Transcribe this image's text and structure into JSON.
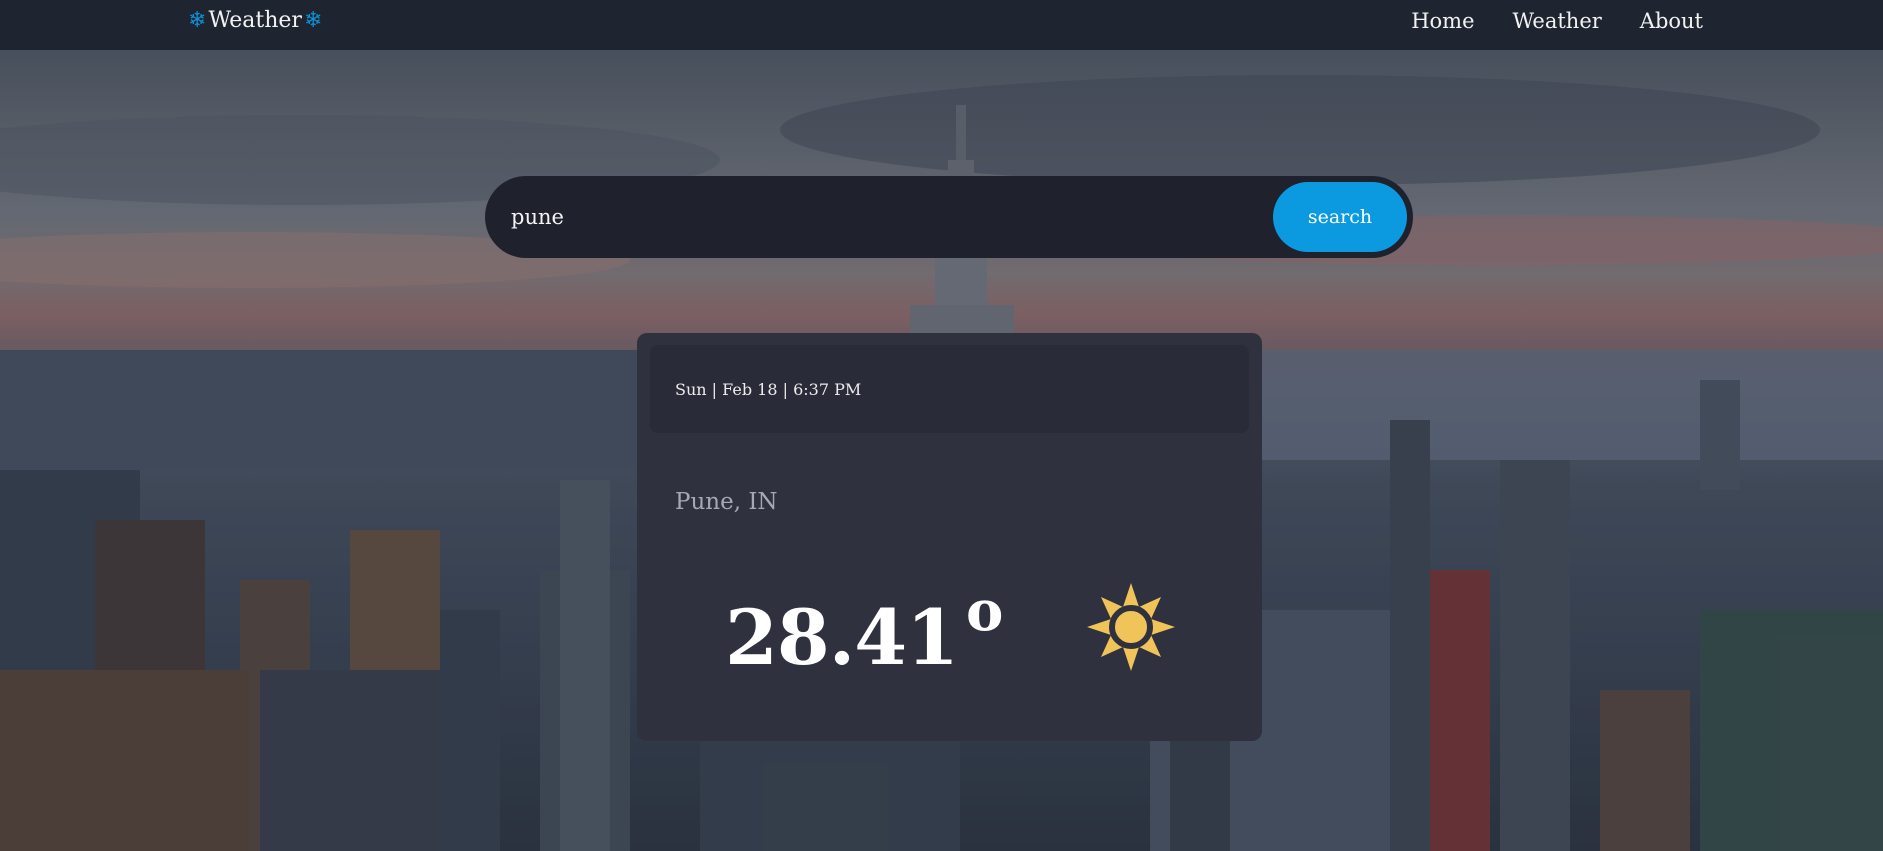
{
  "nav": {
    "brand_text": "Weather",
    "brand_icon": "snowflake-icon",
    "links": [
      {
        "label": "Home"
      },
      {
        "label": "Weather"
      },
      {
        "label": "About"
      }
    ]
  },
  "search": {
    "value": "pune",
    "button_label": "search"
  },
  "card": {
    "date": "Sun | Feb 18 | 6:37 PM",
    "location": "Pune, IN",
    "temperature": "28.41",
    "degree_symbol": "o",
    "condition_icon": "sun-icon"
  },
  "colors": {
    "navbar": "#1f2530",
    "accent": "#0b9ae0",
    "card": "#2f313f",
    "sun": "#f1c45a"
  }
}
